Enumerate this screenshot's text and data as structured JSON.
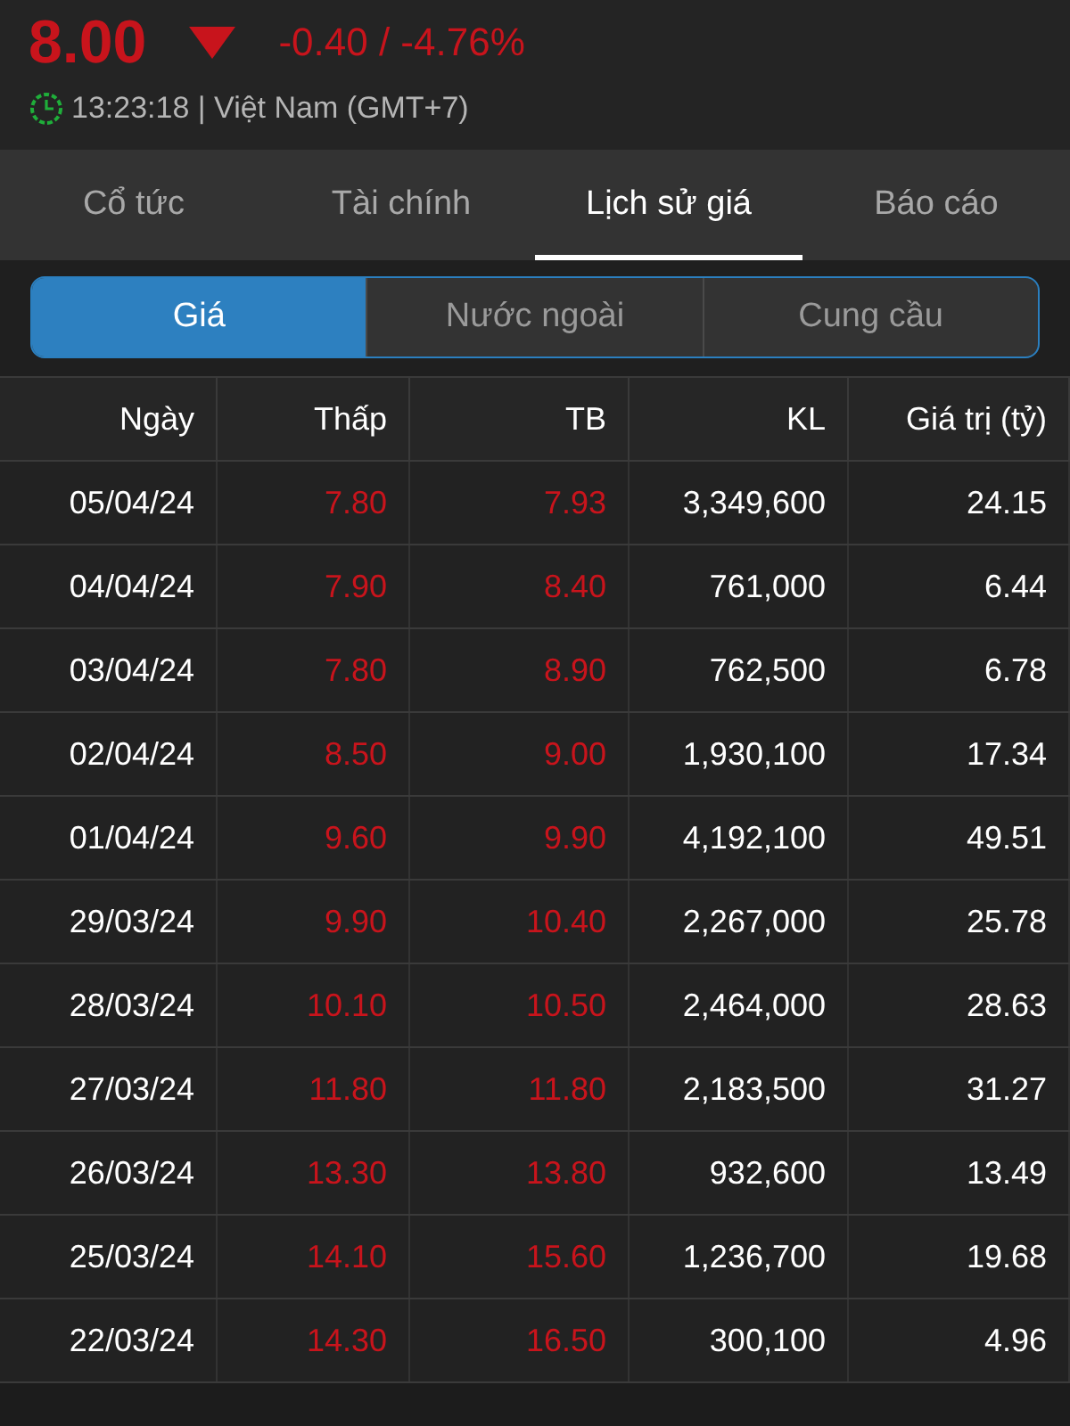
{
  "quote": {
    "price": "8.00",
    "change": "-0.40 / -4.76%",
    "time": "13:23:18 | Việt Nam (GMT+7)"
  },
  "tabs": [
    {
      "label": "Cổ tức",
      "selected": false
    },
    {
      "label": "Tài chính",
      "selected": false
    },
    {
      "label": "Lịch sử giá",
      "selected": true
    },
    {
      "label": "Báo cáo",
      "selected": false
    }
  ],
  "segments": [
    {
      "label": "Giá",
      "selected": true
    },
    {
      "label": "Nước ngoài",
      "selected": false
    },
    {
      "label": "Cung cầu",
      "selected": false
    }
  ],
  "table": {
    "columns": [
      {
        "label": "Ngày",
        "color": "#ffffff"
      },
      {
        "label": "Thấp",
        "color": "#c8141c"
      },
      {
        "label": "TB",
        "color": "#c8141c"
      },
      {
        "label": "KL",
        "color": "#ffffff"
      },
      {
        "label": "Giá trị (tỷ)",
        "color": "#ffffff"
      }
    ],
    "rows": [
      [
        "05/04/24",
        "7.80",
        "7.93",
        "3,349,600",
        "24.15"
      ],
      [
        "04/04/24",
        "7.90",
        "8.40",
        "761,000",
        "6.44"
      ],
      [
        "03/04/24",
        "7.80",
        "8.90",
        "762,500",
        "6.78"
      ],
      [
        "02/04/24",
        "8.50",
        "9.00",
        "1,930,100",
        "17.34"
      ],
      [
        "01/04/24",
        "9.60",
        "9.90",
        "4,192,100",
        "49.51"
      ],
      [
        "29/03/24",
        "9.90",
        "10.40",
        "2,267,000",
        "25.78"
      ],
      [
        "28/03/24",
        "10.10",
        "10.50",
        "2,464,000",
        "28.63"
      ],
      [
        "27/03/24",
        "11.80",
        "11.80",
        "2,183,500",
        "31.27"
      ],
      [
        "26/03/24",
        "13.30",
        "13.80",
        "932,600",
        "13.49"
      ],
      [
        "25/03/24",
        "14.10",
        "15.60",
        "1,236,700",
        "19.68"
      ],
      [
        "22/03/24",
        "14.30",
        "16.50",
        "300,100",
        "4.96"
      ]
    ]
  }
}
